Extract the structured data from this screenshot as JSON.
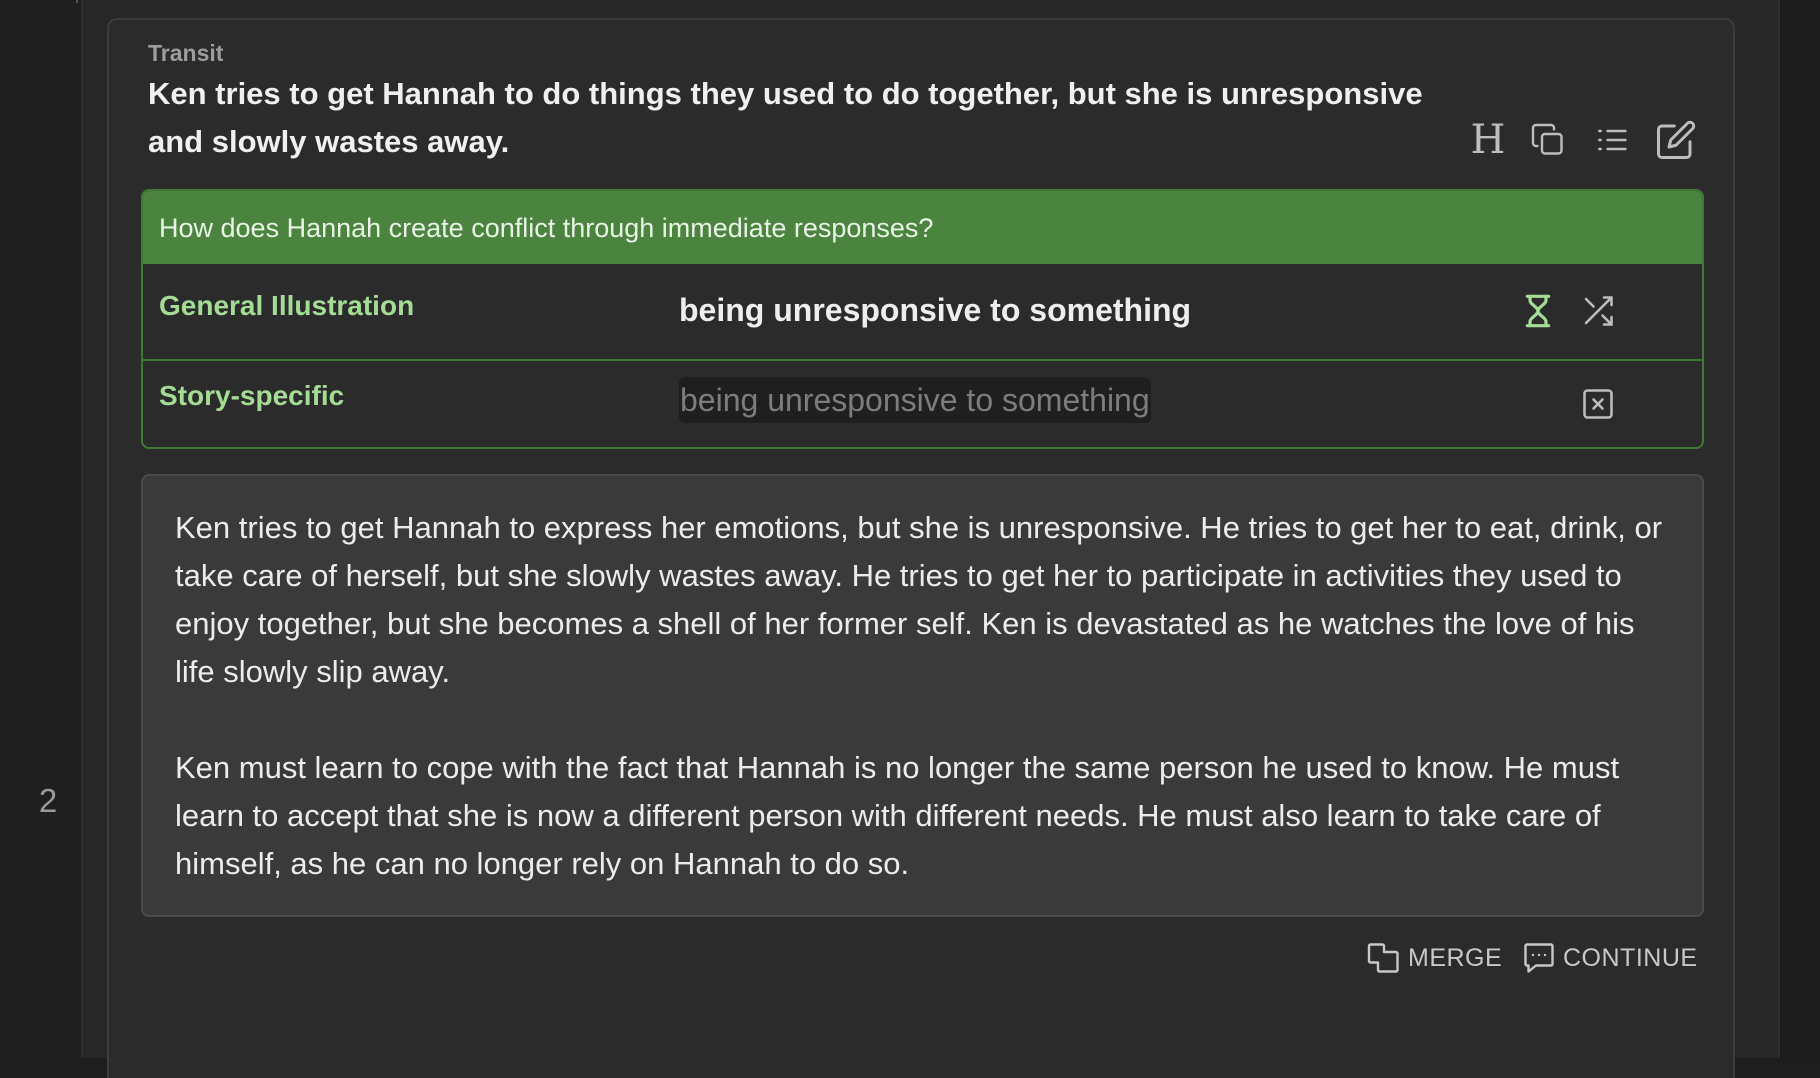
{
  "gutter": {
    "line_number": "2"
  },
  "beat": {
    "section_label": "Transit",
    "title": "Ken tries to get Hannah to do things they used to do together, but she is unresponsive and slowly wastes away."
  },
  "toolbar": {
    "icons": [
      "heading-icon",
      "copy-icon",
      "list-icon",
      "edit-icon"
    ]
  },
  "question": {
    "text": "How does Hannah create conflict through immediate responses?",
    "accent_color": "#4a843e",
    "rows": [
      {
        "label": "General Illustration",
        "value": "being unresponsive to something",
        "icons": [
          "hourglass-icon",
          "shuffle-icon"
        ]
      },
      {
        "label": "Story-specific",
        "value": "being unresponsive to something",
        "icons": [
          "clear-icon"
        ]
      }
    ]
  },
  "body": {
    "paragraphs": [
      "Ken tries to get Hannah to express her emotions, but she is unresponsive. He tries to get her to eat, drink, or take care of herself, but she slowly wastes away. He tries to get her to participate in activities they used to enjoy together, but she becomes a shell of her former self. Ken is devastated as he watches the love of his life slowly slip away.",
      "Ken must learn to cope with the fact that Hannah is no longer the same person he used to know. He must learn to accept that she is now a different person with different needs. He must also learn to take care of himself, as he can no longer rely on Hannah to do so."
    ]
  },
  "actions": {
    "merge_label": "MERGE",
    "continue_label": "CONTINUE"
  }
}
